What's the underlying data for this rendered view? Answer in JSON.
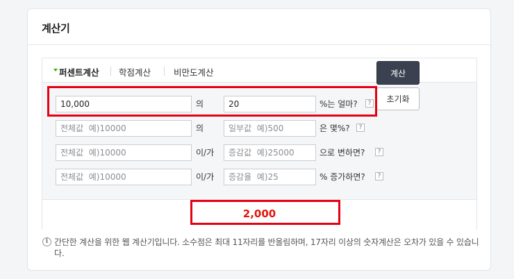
{
  "card": {
    "title": "계산기"
  },
  "tabs": [
    {
      "label": "퍼센트계산",
      "active": true
    },
    {
      "label": "학점계산",
      "active": false
    },
    {
      "label": "비만도계산",
      "active": false
    }
  ],
  "rows": [
    {
      "field1": {
        "value": "10,000",
        "placeholder": "전체값  예)10000"
      },
      "connector": "의",
      "field2": {
        "value": "20",
        "placeholder": "일부값  예)500"
      },
      "suffix": "%는 얼마?",
      "help": "?"
    },
    {
      "field1": {
        "value": "",
        "placeholder": "전체값  예)10000"
      },
      "connector": "의",
      "field2": {
        "value": "",
        "placeholder": "일부값  예)500"
      },
      "suffix": "은 몇%?",
      "help": "?"
    },
    {
      "field1": {
        "value": "",
        "placeholder": "전체값  예)10000"
      },
      "connector": "이/가",
      "field2": {
        "value": "",
        "placeholder": "증감값  예)25000"
      },
      "suffix": "으로 변하면?",
      "help": "?"
    },
    {
      "field1": {
        "value": "",
        "placeholder": "전체값  예)10000"
      },
      "connector": "이/가",
      "field2": {
        "value": "",
        "placeholder": "증감율  예)25"
      },
      "suffix": "% 증가하면?",
      "help": "?"
    }
  ],
  "buttons": {
    "calculate": "계산",
    "reset": "초기화"
  },
  "result": {
    "value": "2,000"
  },
  "info": {
    "icon": "info-icon",
    "note": "간단한 계산을 위한 웹 계산기입니다. 소수점은 최대 11자리를 반올림하며, 17자리 이상의 숫자계산은 오차가 있을 수 있습니다."
  },
  "colors": {
    "accent_tab": "#2db400",
    "result_text": "#e5150b",
    "highlight": "#e60012",
    "calc_button": "#3a4150"
  }
}
